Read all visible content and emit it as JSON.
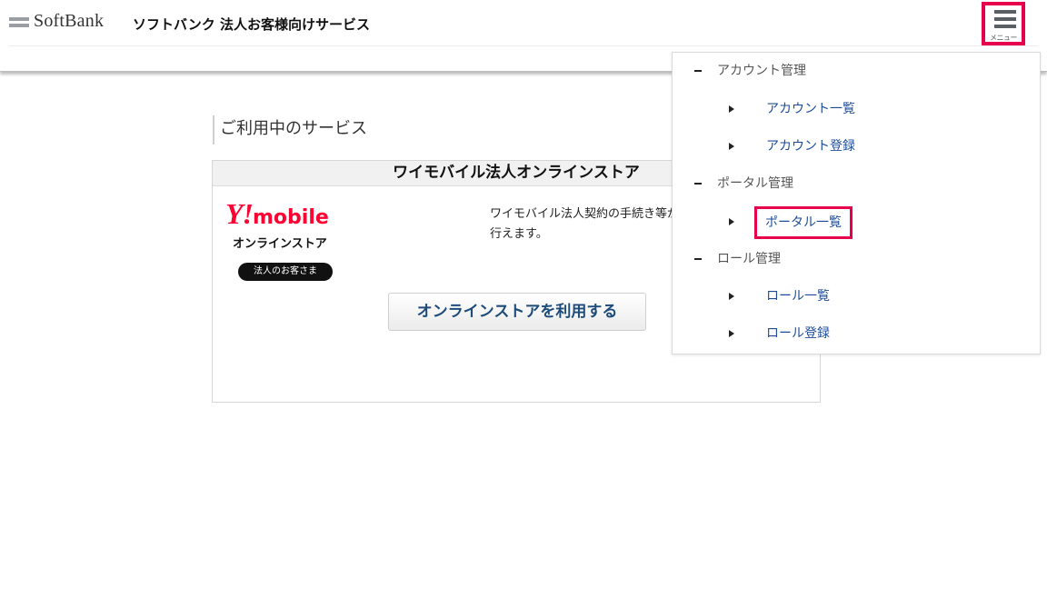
{
  "header": {
    "brand": "SoftBank",
    "service_title": "ソフトバンク 法人お客様向けサービス",
    "menu_label": "メニュー"
  },
  "main": {
    "section_title": "ご利用中のサービス",
    "card": {
      "title": "ワイモバイル法人オンラインストア",
      "logo_y": "Y!",
      "logo_mobile": "mobile",
      "logo_sub": "オンラインストア",
      "badge": "法人のお客さま",
      "description": "ワイモバイル法人契約の手続き等が行えます。",
      "button_label": "オンラインストアを利用する"
    }
  },
  "menu": {
    "groups": [
      {
        "label": "アカウント管理",
        "items": [
          "アカウント一覧",
          "アカウント登録"
        ]
      },
      {
        "label": "ポータル管理",
        "items": [
          "ポータル一覧"
        ]
      },
      {
        "label": "ロール管理",
        "items": [
          "ロール一覧",
          "ロール登録"
        ]
      }
    ],
    "highlighted_item": "ポータル一覧"
  },
  "colors": {
    "accent_highlight": "#e6004b",
    "ymobile_red": "#ff0033",
    "link_blue": "#1d4b9a"
  }
}
